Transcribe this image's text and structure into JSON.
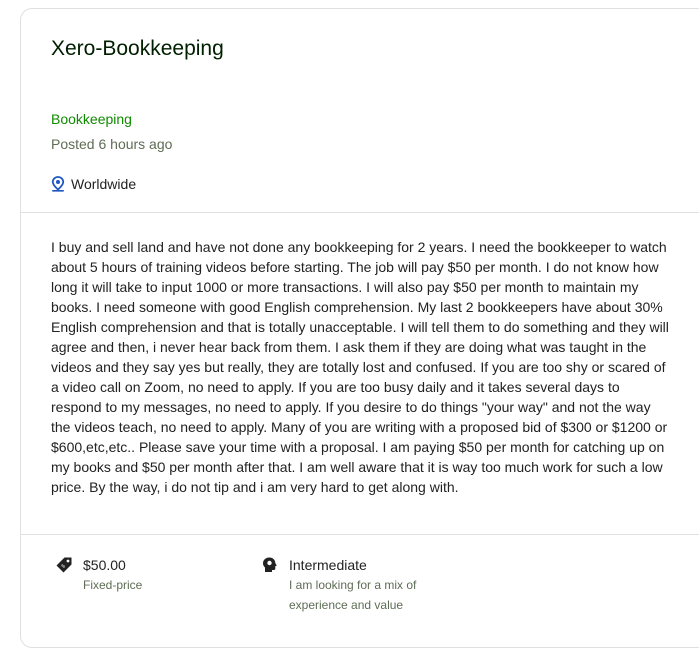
{
  "job": {
    "title": "Xero-Bookkeeping",
    "category": "Bookkeeping",
    "posted": "Posted 6 hours ago",
    "location": "Worldwide",
    "description": "I buy and sell land and have not done any bookkeeping for 2 years. I need the bookkeeper to watch about 5 hours of training videos before starting. The job will pay $50 per month. I do not know how long it will take to input 1000 or more transactions. I will also pay $50 per month to maintain my books. I need someone with good English comprehension. My last 2 bookkeepers have about 30% English comprehension and that is totally unacceptable. I will tell them to do something and they will agree and then, i never hear back from them. I ask them if they are doing what was taught in the videos and they say yes but really, they are totally lost and confused. If you are too shy or scared of a video call on Zoom, no need to apply. If you are too busy daily and it takes several days to respond to my messages, no need to apply. If you desire to do things \"your way\" and not the way the videos teach, no need to apply. Many of you are writing with a proposed bid of $300 or $1200 or $600,etc,etc.. Please save your time with a proposal. I am paying $50 per month for catching up on my books and $50 per month after that. I am well aware that it is way too much work for such a low price. By the way, i do not tip and i am very hard to get along with."
  },
  "features": {
    "budget": {
      "amount": "$50.00",
      "type": "Fixed-price",
      "icon": "price-tag-icon"
    },
    "level": {
      "label": "Intermediate",
      "description": "I am looking for a mix of experience and value",
      "icon": "experience-level-icon"
    }
  },
  "colors": {
    "accent_green": "#108a00",
    "location_icon": "#1f57c3",
    "border": "#e0e0e0"
  }
}
